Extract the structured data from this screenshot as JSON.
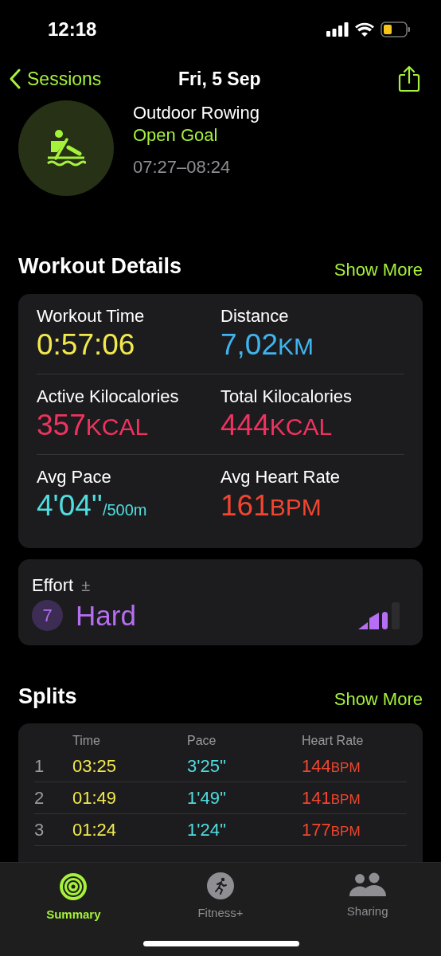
{
  "status_bar": {
    "time": "12:18"
  },
  "nav": {
    "back": "Sessions",
    "title": "Fri, 5 Sep"
  },
  "workout": {
    "name": "Outdoor Rowing",
    "goal": "Open Goal",
    "time_range": "07:27–08:24"
  },
  "details": {
    "title": "Workout Details",
    "action": "Show More",
    "metrics": [
      {
        "label": "Workout Time",
        "value": "0:57:06",
        "color": "#f2e94e"
      },
      {
        "label": "Distance",
        "value": "7,02",
        "unit": "KM",
        "color": "#3fb5f0"
      },
      {
        "label": "Active Kilocalories",
        "value": "357",
        "unit": "KCAL",
        "color": "#f0325f"
      },
      {
        "label": "Total Kilocalories",
        "value": "444",
        "unit": "KCAL",
        "color": "#f0325f"
      },
      {
        "label": "Avg Pace",
        "value": "4'04''",
        "unit": "/500m",
        "color": "#4fdde0"
      },
      {
        "label": "Avg Heart Rate",
        "value": "161",
        "unit": "BPM",
        "color": "#f2452f"
      }
    ]
  },
  "effort": {
    "label": "Effort",
    "adjust": "±",
    "score": "7",
    "rating": "Hard"
  },
  "splits": {
    "title": "Splits",
    "action": "Show More",
    "columns": [
      "Time",
      "Pace",
      "Heart Rate"
    ],
    "rows": [
      {
        "index": "1",
        "time": "03:25",
        "pace": "3'25''",
        "heart_rate": "144",
        "unit": "BPM"
      },
      {
        "index": "2",
        "time": "01:49",
        "pace": "1'49''",
        "heart_rate": "141",
        "unit": "BPM"
      },
      {
        "index": "3",
        "time": "01:24",
        "pace": "1'24''",
        "heart_rate": "177",
        "unit": "BPM"
      }
    ]
  },
  "tabs": [
    {
      "label": "Summary",
      "kind": "rings",
      "selected": true
    },
    {
      "label": "Fitness+",
      "kind": "runner",
      "selected": false
    },
    {
      "label": "Sharing",
      "kind": "people",
      "selected": false
    }
  ]
}
